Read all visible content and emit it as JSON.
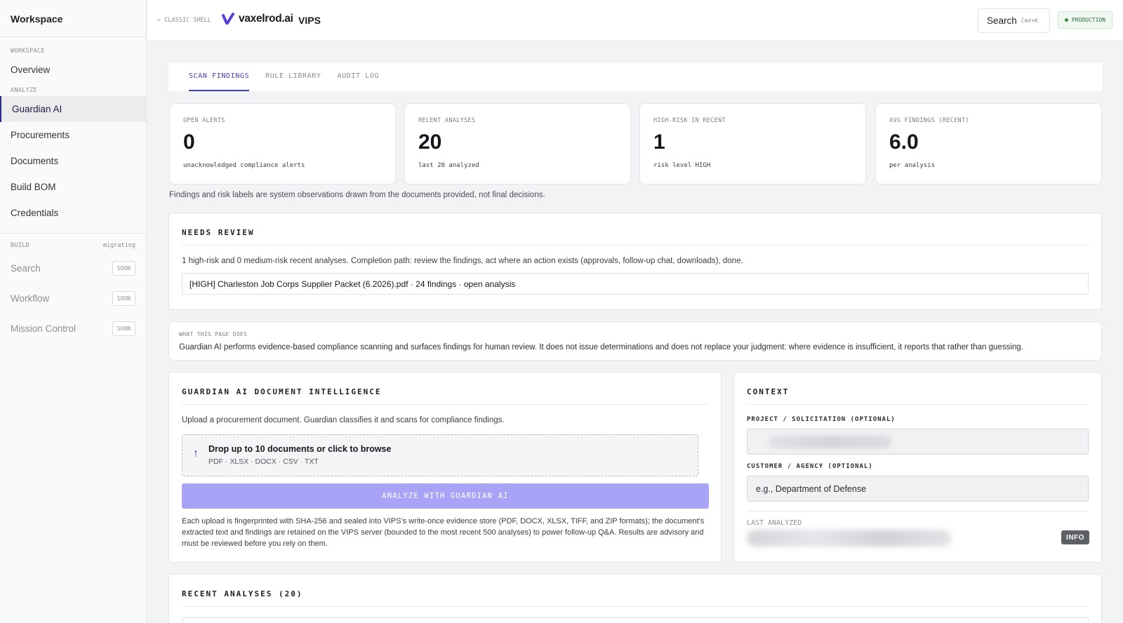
{
  "sidebar": {
    "title": "Workspace",
    "sections": {
      "workspace": "WORKSPACE",
      "analyze": "ANALYZE",
      "build": "BUILD",
      "build_note": "migrating"
    },
    "items": {
      "overview": "Overview",
      "guardian": "Guardian AI",
      "procurements": "Procurements",
      "documents": "Documents",
      "build_bom": "Build BOM",
      "credentials": "Credentials"
    },
    "soon_items": [
      {
        "label": "Search",
        "badge": "SOON"
      },
      {
        "label": "Workflow",
        "badge": "SOON"
      },
      {
        "label": "Mission Control",
        "badge": "SOON"
      }
    ]
  },
  "topbar": {
    "classic_link": "← CLASSIC SHELL",
    "brand": "vaxelrod.ai",
    "app": "VIPS",
    "search_label": "Search",
    "search_shortcut": "Cmd+K",
    "env_badge": "PRODUCTION"
  },
  "tabs": [
    "SCAN FINDINGS",
    "RULE LIBRARY",
    "AUDIT LOG"
  ],
  "stats": [
    {
      "label": "OPEN ALERTS",
      "value": "0",
      "sub": "unacknowledged compliance alerts"
    },
    {
      "label": "RECENT ANALYSES",
      "value": "20",
      "sub": "last 20 analyzed"
    },
    {
      "label": "HIGH-RISK IN RECENT",
      "value": "1",
      "sub": "risk level HIGH"
    },
    {
      "label": "AVG FINDINGS (RECENT)",
      "value": "6.0",
      "sub": "per analysis"
    }
  ],
  "disclaimer": "Findings and risk labels are system observations drawn from the documents provided, not final decisions.",
  "needs_review": {
    "title": "NEEDS REVIEW",
    "text": "1 high-risk and 0 medium-risk recent analyses. Completion path: review the findings, act where an action exists (approvals, follow-up chat, downloads), done.",
    "row": "[HIGH] Charleston Job Corps Supplier Packet (6.2026).pdf · 24 findings · open analysis"
  },
  "what": {
    "label": "WHAT THIS PAGE DOES",
    "text": "Guardian AI performs evidence-based compliance scanning and surfaces findings for human review. It does not issue determinations and does not replace your judgment: where evidence is insufficient, it reports that rather than guessing."
  },
  "intel": {
    "title": "GUARDIAN AI DOCUMENT INTELLIGENCE",
    "intro": "Upload a procurement document. Guardian classifies it and scans for compliance findings.",
    "drop_main": "Drop up to 10 documents or click to browse",
    "drop_sub": "PDF · XLSX · DOCX · CSV · TXT",
    "button": "ANALYZE WITH GUARDIAN AI",
    "note": "Each upload is fingerprinted with SHA-256 and sealed into VIPS's write-once evidence store (PDF, DOCX, XLSX, TIFF, and ZIP formats); the document's extracted text and findings are retained on the VIPS server (bounded to the most recent 500 analyses) to power follow-up Q&A. Results are advisory and must be reviewed before you rely on them."
  },
  "context": {
    "title": "CONTEXT",
    "project_label": "PROJECT / SOLICITATION (OPTIONAL)",
    "customer_label": "CUSTOMER / AGENCY (OPTIONAL)",
    "customer_placeholder": "e.g., Department of Defense",
    "last_label": "LAST ANALYZED",
    "info_badge": "INFO"
  },
  "recent": {
    "title": "RECENT ANALYSES (20)"
  },
  "colors": {
    "accent": "#3f3fb0",
    "button": "#a9a3f7",
    "env_green": "#2d6b3a"
  }
}
